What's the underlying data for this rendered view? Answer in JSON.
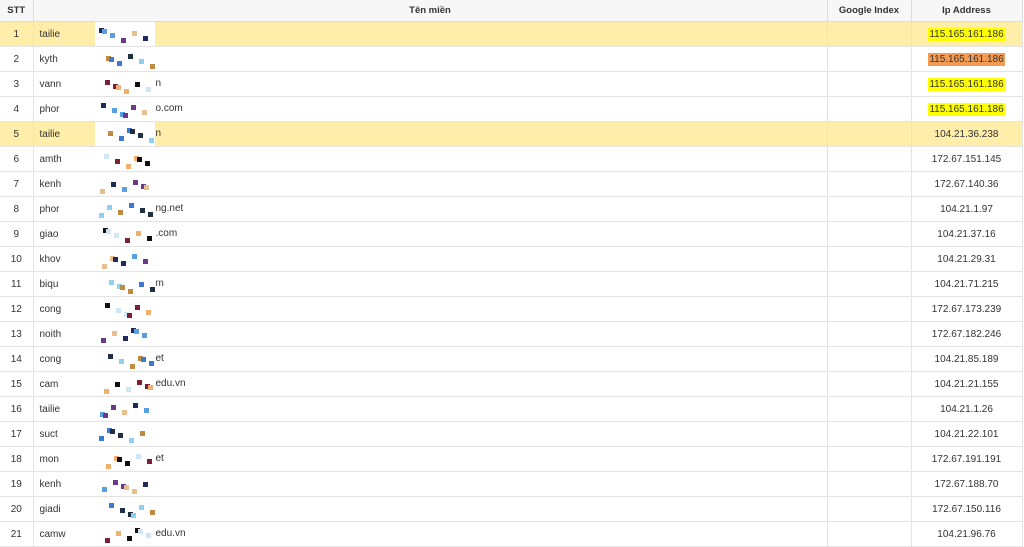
{
  "table": {
    "headers": {
      "stt": "STT",
      "name": "Tên miền",
      "google_index": "Google Index",
      "ip": "Ip Address"
    },
    "rows": [
      {
        "stt": "1",
        "name": "tailie",
        "google_index": "",
        "ip": "115.165.161.186",
        "highlight": true,
        "ip_color": "yellow"
      },
      {
        "stt": "2",
        "name": "kyth",
        "google_index": "",
        "ip": "115.165.161.186",
        "highlight": false,
        "ip_color": "orange"
      },
      {
        "stt": "3",
        "name": "vann",
        "suffix": "n",
        "google_index": "",
        "ip": "115.165.161.186",
        "highlight": false,
        "ip_color": "yellow"
      },
      {
        "stt": "4",
        "name": "phor",
        "suffix": "o.com",
        "google_index": "",
        "ip": "115.165.161.186",
        "highlight": false,
        "ip_color": "yellow"
      },
      {
        "stt": "5",
        "name": "tailie",
        "suffix": "n",
        "google_index": "",
        "ip": "104.21.36.238",
        "highlight": true,
        "ip_color": ""
      },
      {
        "stt": "6",
        "name": "amth",
        "google_index": "",
        "ip": "172.67.151.145",
        "highlight": false,
        "ip_color": ""
      },
      {
        "stt": "7",
        "name": "kenh",
        "google_index": "",
        "ip": "172.67.140.36",
        "highlight": false,
        "ip_color": ""
      },
      {
        "stt": "8",
        "name": "phor",
        "suffix": "ng.net",
        "google_index": "",
        "ip": "104.21.1.97",
        "highlight": false,
        "ip_color": ""
      },
      {
        "stt": "9",
        "name": "giao",
        "suffix": ".com",
        "google_index": "",
        "ip": "104.21.37.16",
        "highlight": false,
        "ip_color": ""
      },
      {
        "stt": "10",
        "name": "khov",
        "google_index": "",
        "ip": "104.21.29.31",
        "highlight": false,
        "ip_color": ""
      },
      {
        "stt": "11",
        "name": "biqu",
        "suffix": "m",
        "google_index": "",
        "ip": "104.21.71.215",
        "highlight": false,
        "ip_color": ""
      },
      {
        "stt": "12",
        "name": "cong",
        "google_index": "",
        "ip": "172.67.173.239",
        "highlight": false,
        "ip_color": ""
      },
      {
        "stt": "13",
        "name": "noith",
        "google_index": "",
        "ip": "172.67.182.246",
        "highlight": false,
        "ip_color": ""
      },
      {
        "stt": "14",
        "name": "cong",
        "suffix": "et",
        "google_index": "",
        "ip": "104.21.85.189",
        "highlight": false,
        "ip_color": ""
      },
      {
        "stt": "15",
        "name": "cam",
        "suffix": "edu.vn",
        "google_index": "",
        "ip": "104.21.21.155",
        "highlight": false,
        "ip_color": ""
      },
      {
        "stt": "16",
        "name": "tailie",
        "google_index": "",
        "ip": "104.21.1.26",
        "highlight": false,
        "ip_color": ""
      },
      {
        "stt": "17",
        "name": "suct",
        "google_index": "",
        "ip": "104.21.22.101",
        "highlight": false,
        "ip_color": ""
      },
      {
        "stt": "18",
        "name": "mon",
        "suffix": "et",
        "google_index": "",
        "ip": "172.67.191.191",
        "highlight": false,
        "ip_color": ""
      },
      {
        "stt": "19",
        "name": "kenh",
        "google_index": "",
        "ip": "172.67.188.70",
        "highlight": false,
        "ip_color": ""
      },
      {
        "stt": "20",
        "name": "giadi",
        "google_index": "",
        "ip": "172.67.150.116",
        "highlight": false,
        "ip_color": ""
      },
      {
        "stt": "21",
        "name": "camw",
        "suffix": "edu.vn",
        "google_index": "",
        "ip": "104.21.96.76",
        "highlight": false,
        "ip_color": ""
      }
    ]
  },
  "colors": {
    "row_highlight": "#feeeaa",
    "ip_yellow": "#ffff00",
    "ip_orange": "#f49b53",
    "header_bg": "#f7f7f7"
  }
}
